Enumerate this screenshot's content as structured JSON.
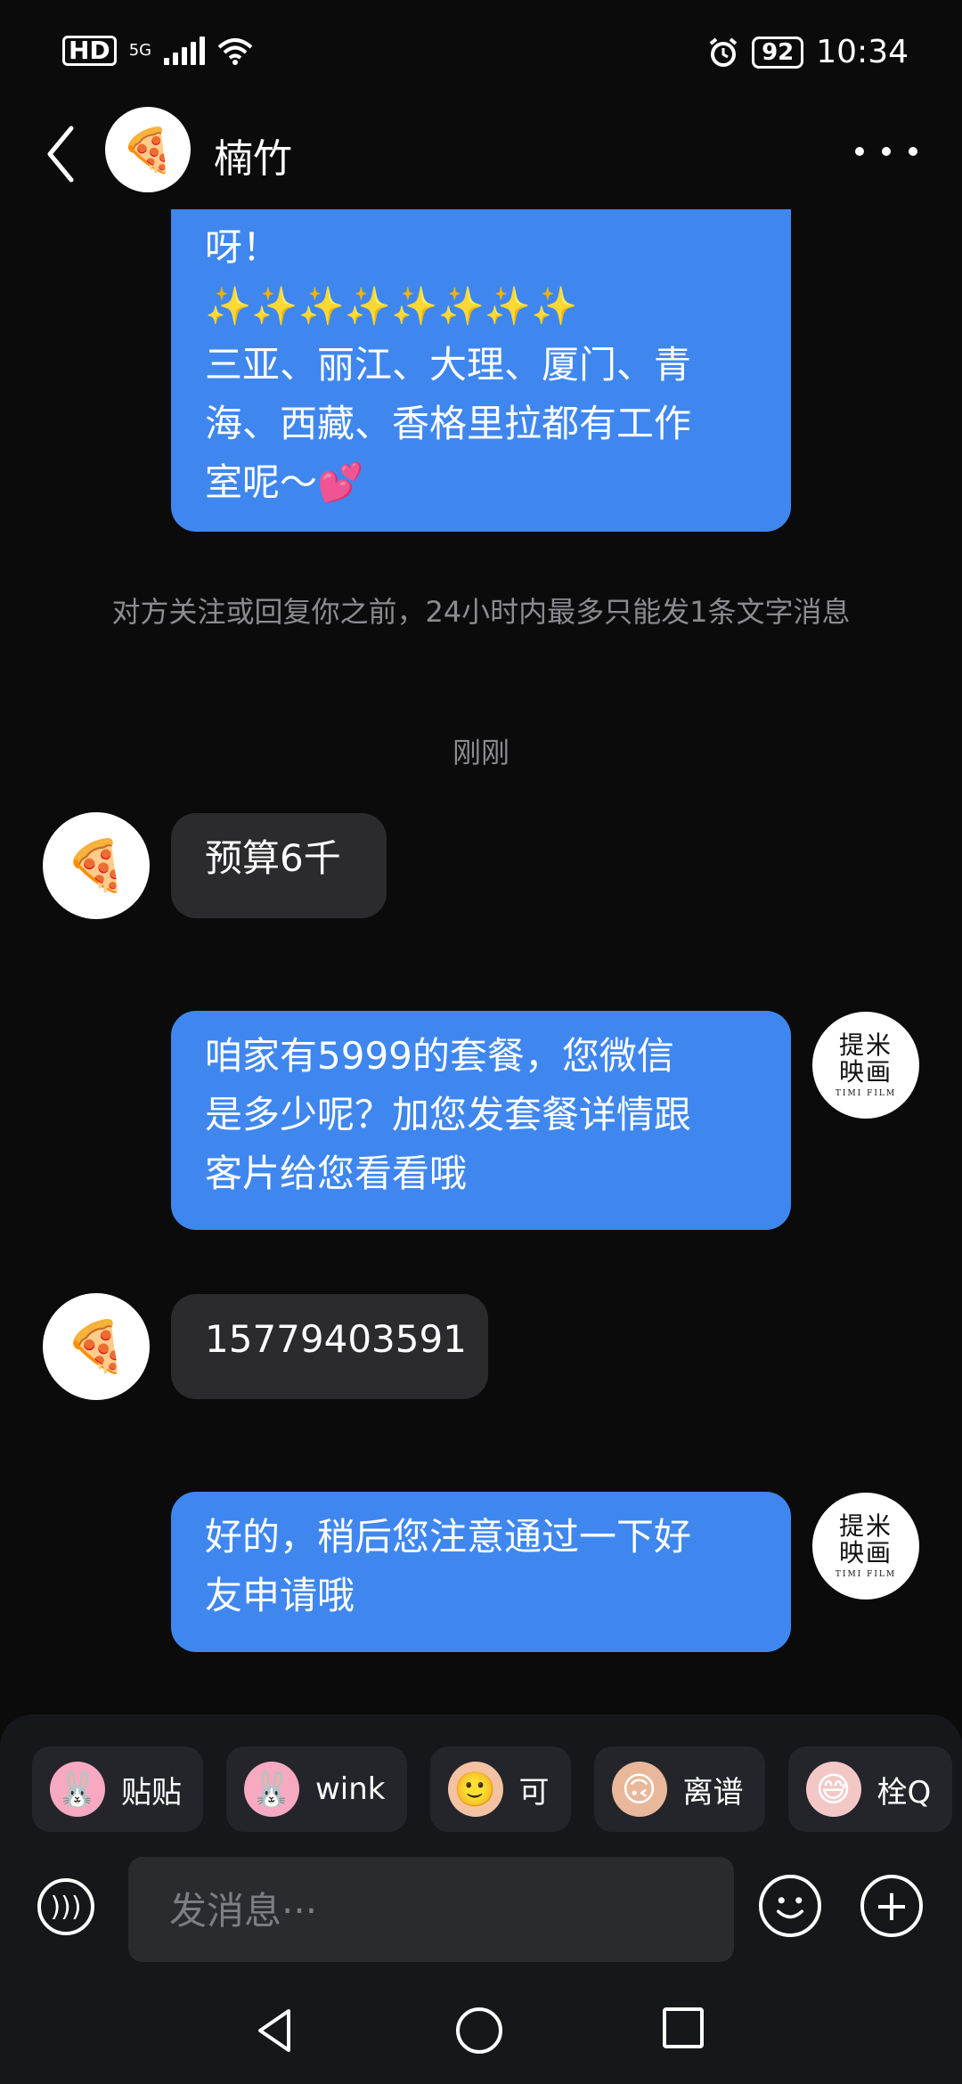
{
  "status_bar": {
    "hd": "HD",
    "network": "5G",
    "battery": "92",
    "time": "10:34"
  },
  "header": {
    "title": "楠竹",
    "back_icon": "chevron-left-icon",
    "more_icon": "more-horizontal-icon"
  },
  "messages": {
    "m1": [
      "呀！",
      "✨✨✨✨✨✨✨✨",
      "三亚、丽江、大理、厦门、青",
      "海、西藏、香格里拉都有工作",
      "室呢～💕"
    ],
    "m2": "预算6千",
    "m3": [
      "咱家有5999的套餐，您微信",
      "是多少呢？加您发套餐详情跟",
      "客片给您看看哦"
    ],
    "m4": "15779403591",
    "m5": [
      "好的，稍后您注意通过一下好",
      "友申请哦"
    ]
  },
  "notice": "对方关注或回复你之前，24小时内最多只能发1条文字消息",
  "timestamp": "刚刚",
  "avatars": {
    "other": "🍕",
    "self_logo_line1": "提米",
    "self_logo_line2": "映画",
    "self_logo_sub": "TIMI FILM"
  },
  "stickers": [
    {
      "label": "贴贴",
      "icon": "🐰",
      "color": "#f6a9c0"
    },
    {
      "label": "wink",
      "icon": "🐰",
      "color": "#f6a9c0"
    },
    {
      "label": "可",
      "icon": "🙂",
      "color": "#f2c2a2"
    },
    {
      "label": "离谱",
      "icon": "🙃",
      "color": "#e9b79a"
    },
    {
      "label": "栓Q",
      "icon": "😅",
      "color": "#f4c7c7"
    }
  ],
  "composer": {
    "placeholder": "发消息···"
  }
}
